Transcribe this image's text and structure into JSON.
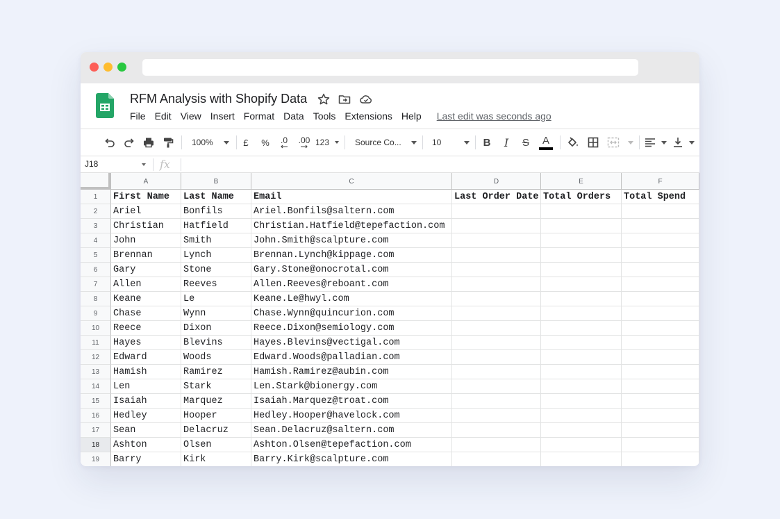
{
  "doc": {
    "title": "RFM Analysis with Shopify Data",
    "last_edit": "Last edit was seconds ago"
  },
  "menu": [
    "File",
    "Edit",
    "View",
    "Insert",
    "Format",
    "Data",
    "Tools",
    "Extensions",
    "Help"
  ],
  "toolbar": {
    "zoom": "100%",
    "currency": "£",
    "percent": "%",
    "decimal_decrease": ".0",
    "decimal_increase": ".00",
    "more_formats": "123",
    "font": "Source Co...",
    "font_size": "10"
  },
  "formula_bar": {
    "name_box": "J18",
    "fx": "fx"
  },
  "columns": [
    "A",
    "B",
    "C",
    "D",
    "E",
    "F"
  ],
  "headers": [
    "First Name",
    "Last Name",
    "Email",
    "Last Order Date",
    "Total Orders",
    "Total Spend"
  ],
  "rows": [
    {
      "n": "2",
      "first": "Ariel",
      "last": "Bonfils",
      "email": "Ariel.Bonfils@saltern.com"
    },
    {
      "n": "3",
      "first": "Christian",
      "last": "Hatfield",
      "email": "Christian.Hatfield@tepefaction.com"
    },
    {
      "n": "4",
      "first": "John",
      "last": "Smith",
      "email": "John.Smith@scalpture.com"
    },
    {
      "n": "5",
      "first": "Brennan",
      "last": "Lynch",
      "email": "Brennan.Lynch@kippage.com"
    },
    {
      "n": "6",
      "first": "Gary",
      "last": "Stone",
      "email": "Gary.Stone@onocrotal.com"
    },
    {
      "n": "7",
      "first": "Allen",
      "last": "Reeves",
      "email": "Allen.Reeves@reboant.com"
    },
    {
      "n": "8",
      "first": "Keane",
      "last": "Le",
      "email": "Keane.Le@hwyl.com"
    },
    {
      "n": "9",
      "first": "Chase",
      "last": "Wynn",
      "email": "Chase.Wynn@quincurion.com"
    },
    {
      "n": "10",
      "first": "Reece",
      "last": "Dixon",
      "email": "Reece.Dixon@semiology.com"
    },
    {
      "n": "11",
      "first": "Hayes",
      "last": "Blevins",
      "email": "Hayes.Blevins@vectigal.com"
    },
    {
      "n": "12",
      "first": "Edward",
      "last": "Woods",
      "email": "Edward.Woods@palladian.com"
    },
    {
      "n": "13",
      "first": "Hamish",
      "last": "Ramirez",
      "email": "Hamish.Ramirez@aubin.com"
    },
    {
      "n": "14",
      "first": "Len",
      "last": "Stark",
      "email": "Len.Stark@bionergy.com"
    },
    {
      "n": "15",
      "first": "Isaiah",
      "last": "Marquez",
      "email": "Isaiah.Marquez@troat.com"
    },
    {
      "n": "16",
      "first": "Hedley",
      "last": "Hooper",
      "email": "Hedley.Hooper@havelock.com"
    },
    {
      "n": "17",
      "first": "Sean",
      "last": "Delacruz",
      "email": "Sean.Delacruz@saltern.com"
    },
    {
      "n": "18",
      "first": "Ashton",
      "last": "Olsen",
      "email": "Ashton.Olsen@tepefaction.com",
      "active": true
    },
    {
      "n": "19",
      "first": "Barry",
      "last": "Kirk",
      "email": "Barry.Kirk@scalpture.com"
    }
  ],
  "colors": {
    "sheets_green": "#23a566",
    "background": "#eef2fb"
  }
}
